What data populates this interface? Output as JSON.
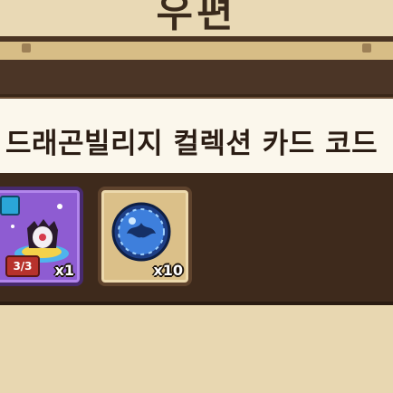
{
  "header": {
    "title": "우편"
  },
  "mail": {
    "title": "드래곤빌리지 컬렉션 카드 코드"
  },
  "rewards": [
    {
      "icon": "costume-card-icon",
      "count": "3/3",
      "quantity": "x1"
    },
    {
      "icon": "blue-coin-icon",
      "quantity": "x10"
    }
  ],
  "colors": {
    "frame_dark": "#4b3526",
    "frame_tan": "#d7bd86",
    "title_bar": "#fbf7ec",
    "reward_strip": "#3e2a1c",
    "purple_card": "#8e5cd2",
    "tan_card": "#dbc089"
  }
}
